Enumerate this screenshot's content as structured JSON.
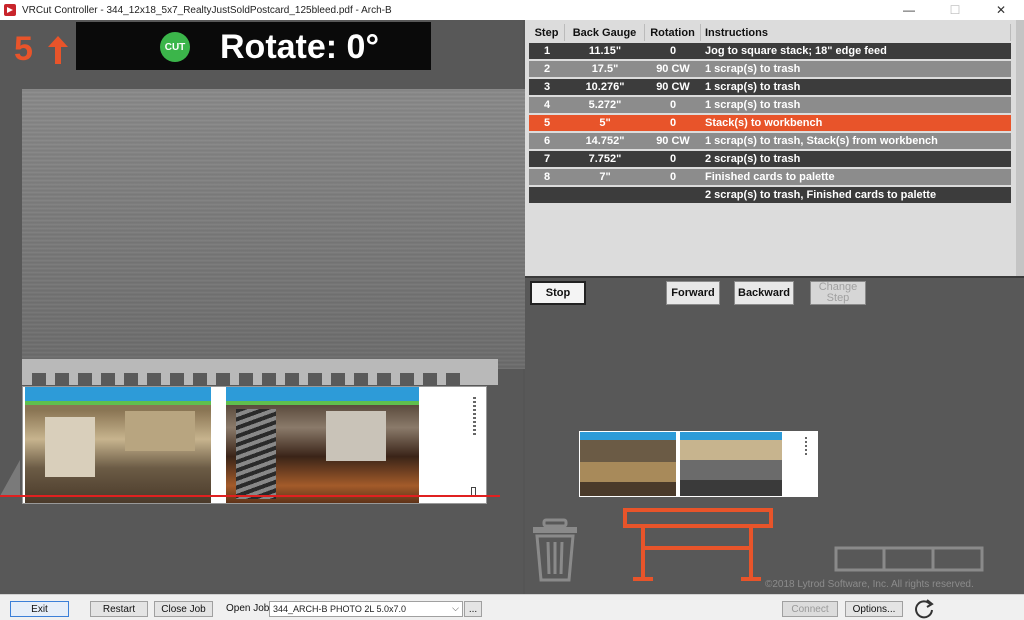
{
  "window": {
    "title": "VRCut Controller - 344_12x18_5x7_RealtyJustSoldPostcard_125bleed.pdf - Arch-B",
    "minimize": "—",
    "maximize": "☐",
    "close": "✕"
  },
  "header": {
    "step_number": "5",
    "cut_badge": "CUT",
    "rotate_text": "Rotate: 0°"
  },
  "table": {
    "headers": [
      "Step",
      "Back Gauge",
      "Rotation",
      "Instructions"
    ],
    "rows": [
      {
        "step": "1",
        "gauge": "11.15\"",
        "rotation": "0",
        "instructions": "Jog to square stack; 18\" edge feed"
      },
      {
        "step": "2",
        "gauge": "17.5\"",
        "rotation": "90 CW",
        "instructions": "1 scrap(s) to trash"
      },
      {
        "step": "3",
        "gauge": "10.276\"",
        "rotation": "90 CW",
        "instructions": "1 scrap(s) to trash"
      },
      {
        "step": "4",
        "gauge": "5.272\"",
        "rotation": "0",
        "instructions": "1 scrap(s) to trash"
      },
      {
        "step": "5",
        "gauge": "5\"",
        "rotation": "0",
        "instructions": "Stack(s) to workbench"
      },
      {
        "step": "6",
        "gauge": "14.752\"",
        "rotation": "90 CW",
        "instructions": "1 scrap(s) to trash, Stack(s) from workbench"
      },
      {
        "step": "7",
        "gauge": "7.752\"",
        "rotation": "0",
        "instructions": "2 scrap(s) to trash"
      },
      {
        "step": "8",
        "gauge": "7\"",
        "rotation": "0",
        "instructions": "Finished cards to palette"
      },
      {
        "step": "",
        "gauge": "",
        "rotation": "",
        "instructions": "2 scrap(s) to trash, Finished cards to palette"
      }
    ],
    "active_step": "5"
  },
  "controls": {
    "stop": "Stop",
    "forward": "Forward",
    "backward": "Backward",
    "change_step": "Change Step"
  },
  "copyright": "©2018 Lytrod Software, Inc. All rights reserved.",
  "bottom": {
    "exit": "Exit",
    "restart": "Restart",
    "close_job": "Close Job",
    "open_job_label": "Open Job:",
    "open_job_value": "344_ARCH-B PHOTO 2L 5.0x7.0",
    "browse": "...",
    "connect": "Connect",
    "options": "Options..."
  },
  "colors": {
    "accent": "#e8542a",
    "cut_green": "#3bb54a",
    "cut_line": "#e02020"
  }
}
